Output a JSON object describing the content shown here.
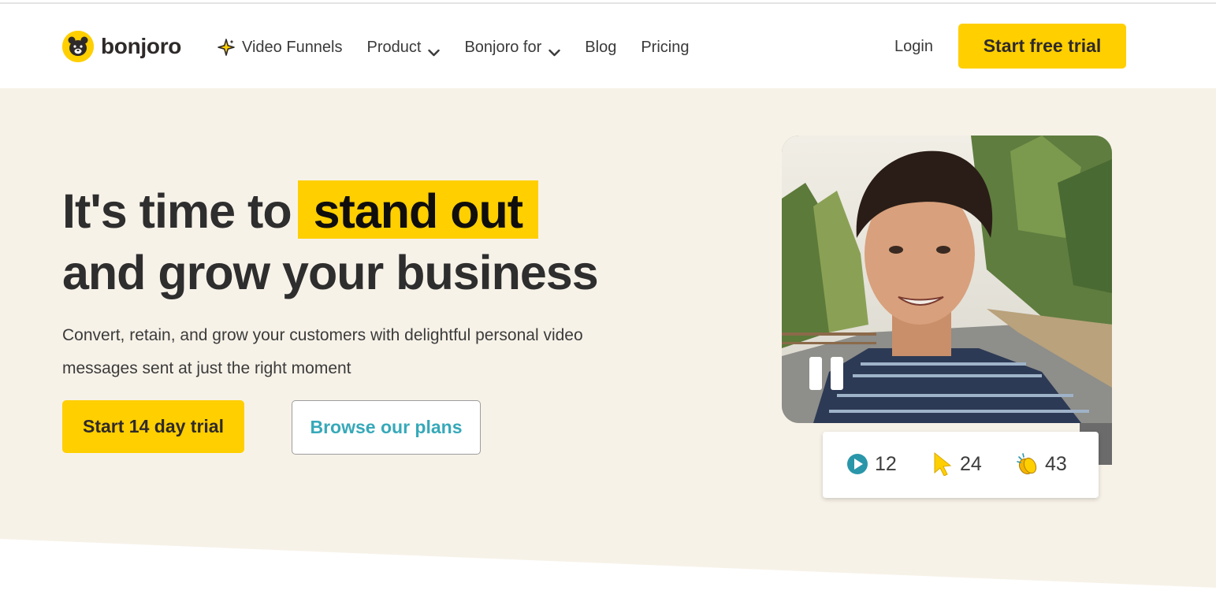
{
  "brand": {
    "name": "bonjoro",
    "accent": "#ffcf00",
    "teal": "#36a9b9"
  },
  "nav": {
    "items": [
      {
        "label": "Video Funnels",
        "icon": "sparkle-icon"
      },
      {
        "label": "Product",
        "icon": "chevron-down-icon"
      },
      {
        "label": "Bonjoro for",
        "icon": "chevron-down-icon"
      },
      {
        "label": "Blog"
      },
      {
        "label": "Pricing"
      }
    ],
    "login": "Login",
    "cta": "Start free trial"
  },
  "hero": {
    "headline_start": "It's time to",
    "headline_highlight": "stand out",
    "headline_end": "and grow your business",
    "subtext": "Convert, retain, and grow your customers with delightful personal video messages sent at just the right moment",
    "primary_button": "Start 14 day trial",
    "secondary_button": "Browse our plans"
  },
  "video": {
    "state_icon": "pause-icon",
    "stats": [
      {
        "icon": "play-icon",
        "value": "12"
      },
      {
        "icon": "cursor-icon",
        "value": "24"
      },
      {
        "icon": "clapping-hands-icon",
        "value": "43"
      }
    ]
  }
}
